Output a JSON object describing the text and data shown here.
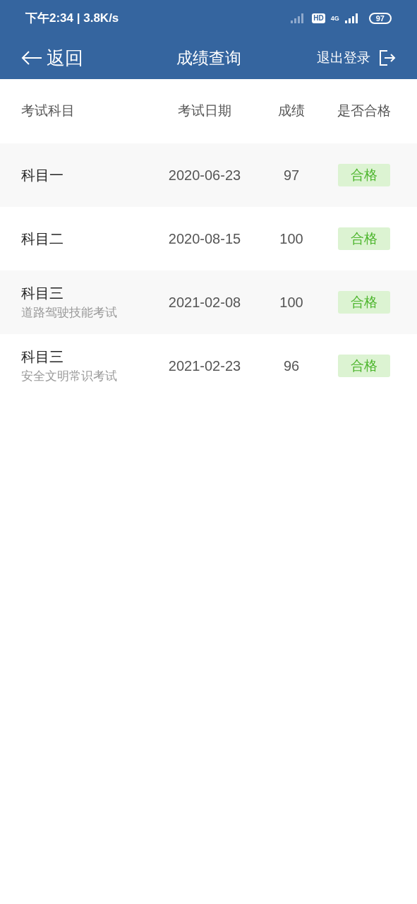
{
  "status_bar": {
    "time_speed": "下午2:34 | 3.8K/s",
    "hd": "HD",
    "network": "4G",
    "battery": "97"
  },
  "header": {
    "back": "返回",
    "title": "成绩查询",
    "logout": "退出登录"
  },
  "table": {
    "columns": [
      "考试科目",
      "考试日期",
      "成绩",
      "是否合格"
    ],
    "rows": [
      {
        "subject": "科目一",
        "date": "2020-06-23",
        "score": "97",
        "result": "合格",
        "passed": true
      },
      {
        "subject": "科目二",
        "date": "2020-08-15",
        "score": "100",
        "result": "合格",
        "passed": true
      },
      {
        "subject": "科目三",
        "note": "道路驾驶技能考试",
        "date": "2021-02-08",
        "score": "100",
        "result": "合格",
        "passed": true
      },
      {
        "subject": "科目三",
        "note": "安全文明常识考试",
        "date": "2021-02-23",
        "score": "96",
        "result": "合格",
        "passed": true
      }
    ]
  }
}
